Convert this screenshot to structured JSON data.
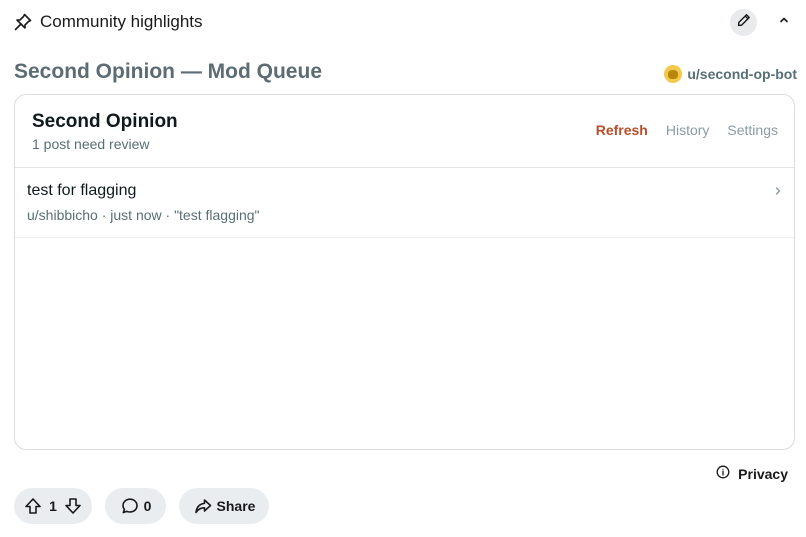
{
  "topbar": {
    "title": "Community highlights",
    "pin_icon": "pin-icon",
    "edit_icon": "pencil-icon",
    "collapse_icon": "chevron-up-icon"
  },
  "post": {
    "title": "Second Opinion — Mod Queue",
    "author": "u/second-op-bot"
  },
  "card": {
    "title": "Second Opinion",
    "subtitle": "1 post need review",
    "actions": [
      "Refresh",
      "History",
      "Settings"
    ],
    "active_action": "Refresh",
    "accent_color": "#b5502b",
    "items": [
      {
        "title": "test for flagging",
        "meta": "u/shibbicho · just now · \"test flagging\""
      }
    ]
  },
  "footer": {
    "privacy_label": "Privacy",
    "vote_count": "1",
    "comment_count": "0",
    "share_label": "Share"
  }
}
